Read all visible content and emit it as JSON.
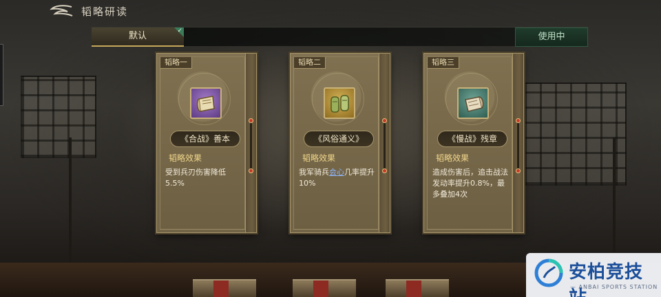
{
  "header": {
    "title": "韬略研读"
  },
  "preset_bar": {
    "default_label": "默认",
    "in_use_label": "使用中"
  },
  "cards": [
    {
      "slot_label": "韬略一",
      "name": "《合战》善本",
      "effect_title": "韬略效果",
      "effect_desc": "受到兵刃伤害降低5.5%",
      "icon": "purple-scroll-icon"
    },
    {
      "slot_label": "韬略二",
      "name": "《风俗通义》",
      "effect_title": "韬略效果",
      "effect_desc_pre": "我军骑兵",
      "effect_desc_kw": "会心",
      "effect_desc_post": "几率提升10%",
      "icon": "gold-scroll-icon"
    },
    {
      "slot_label": "韬略三",
      "name": "《慢战》残章",
      "effect_title": "韬略效果",
      "effect_desc": "造成伤害后，追击战法发动率提升0.8%，最多叠加4次",
      "icon": "teal-scroll-icon"
    }
  ],
  "watermark": {
    "title": "安柏竞技站",
    "subtitle": "— ANBAI SPORTS STATION —"
  },
  "colors": {
    "accent_gold": "#f0d58a",
    "in_use_green": "#bfe0c8",
    "keyword_blue": "#8fb7ff"
  }
}
